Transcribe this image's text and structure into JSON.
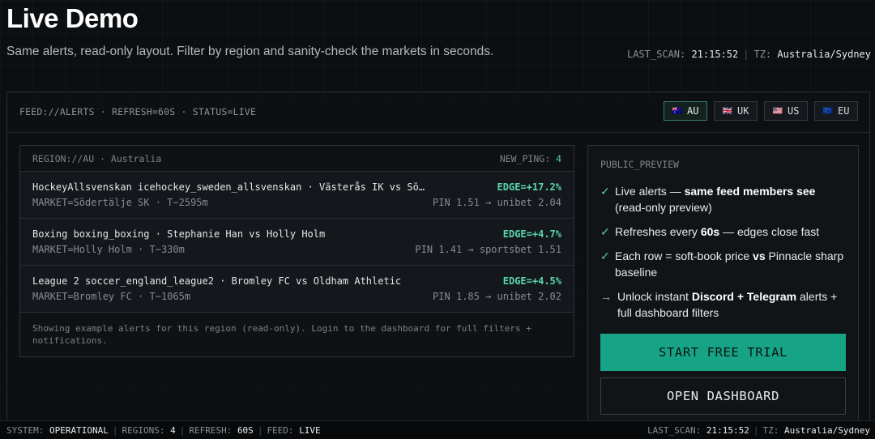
{
  "header": {
    "title": "Live Demo",
    "subtitle": "Same alerts, read-only layout. Filter by region and sanity-check the markets in seconds.",
    "last_scan_label": "LAST_SCAN:",
    "last_scan_value": "21:15:52",
    "tz_label": "TZ:",
    "tz_value": "Australia/Sydney"
  },
  "feed_bar": {
    "text": "FEED://ALERTS · REFRESH=60S · STATUS=LIVE",
    "regions": [
      {
        "flag": "🇦🇺",
        "label": "AU",
        "active": true
      },
      {
        "flag": "🇬🇧",
        "label": "UK",
        "active": false
      },
      {
        "flag": "🇺🇸",
        "label": "US",
        "active": false
      },
      {
        "flag": "🇪🇺",
        "label": "EU",
        "active": false
      }
    ]
  },
  "alerts": {
    "region_text": "REGION://AU · Australia",
    "new_ping_label": "NEW_PING:",
    "new_ping_value": "4",
    "rows": [
      {
        "match": "HockeyAllsvenskan icehockey_sweden_allsvenskan · Västerås IK vs Söder…",
        "edge": "EDGE=+17.2%",
        "market": "MARKET=Södertälje SK · T−2595m",
        "odds": "PIN 1.51 → unibet 2.04"
      },
      {
        "match": "Boxing boxing_boxing · Stephanie Han vs Holly Holm",
        "edge": "EDGE=+4.7%",
        "market": "MARKET=Holly Holm · T−330m",
        "odds": "PIN 1.41 → sportsbet 1.51"
      },
      {
        "match": "League 2 soccer_england_league2 · Bromley FC vs Oldham Athletic",
        "edge": "EDGE=+4.5%",
        "market": "MARKET=Bromley FC · T−1065m",
        "odds": "PIN 1.85 → unibet 2.02"
      }
    ],
    "note": "Showing example alerts for this region (read-only). Login to the dashboard for full filters + notifications."
  },
  "preview": {
    "title": "PUBLIC_PREVIEW",
    "items": [
      {
        "icon": "✓",
        "pre": "Live alerts — ",
        "bold": "same feed members see",
        "post": " (read-only preview)"
      },
      {
        "icon": "✓",
        "pre": "Refreshes every ",
        "bold": "60s",
        "post": " — edges close fast"
      },
      {
        "icon": "✓",
        "pre": "Each row = soft-book price ",
        "bold": "vs",
        "post": " Pinnacle sharp baseline"
      },
      {
        "icon": "→",
        "pre": "Unlock instant ",
        "bold": "Discord + Telegram",
        "post": " alerts + full dashboard filters"
      }
    ],
    "trial_label": "START FREE TRIAL",
    "dashboard_label": "OPEN DASHBOARD"
  },
  "statusbar": {
    "system_label": "SYSTEM:",
    "system_value": "OPERATIONAL",
    "regions_label": "REGIONS:",
    "regions_value": "4",
    "refresh_label": "REFRESH:",
    "refresh_value": "60S",
    "feed_label": "FEED:",
    "feed_value": "LIVE",
    "last_scan_label": "LAST_SCAN:",
    "last_scan_value": "21:15:52",
    "tz_label": "TZ:",
    "tz_value": "Australia/Sydney"
  },
  "colors": {
    "accent": "#17a486",
    "edge": "#5ad6aa",
    "background": "#0c0f12"
  }
}
